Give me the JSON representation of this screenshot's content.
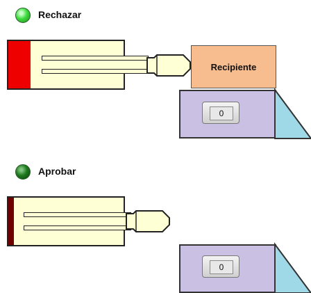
{
  "top_station": {
    "indicator_label": "Rechazar",
    "indicator_state": "on",
    "container_label": "Recipiente",
    "counter_value": "0"
  },
  "bottom_station": {
    "indicator_label": "Aprobar",
    "indicator_state": "off",
    "counter_value": "0"
  },
  "colors": {
    "led_on": "#3fdc3f",
    "led_off": "#1f7a1f",
    "cylinder_body": "#ffffd6",
    "cylinder_cap_active": "#ee0000",
    "cylinder_cap_idle": "#6e0000",
    "container": "#f7bd8e",
    "base": "#c9c0e4",
    "ramp": "#9fd8e6"
  }
}
